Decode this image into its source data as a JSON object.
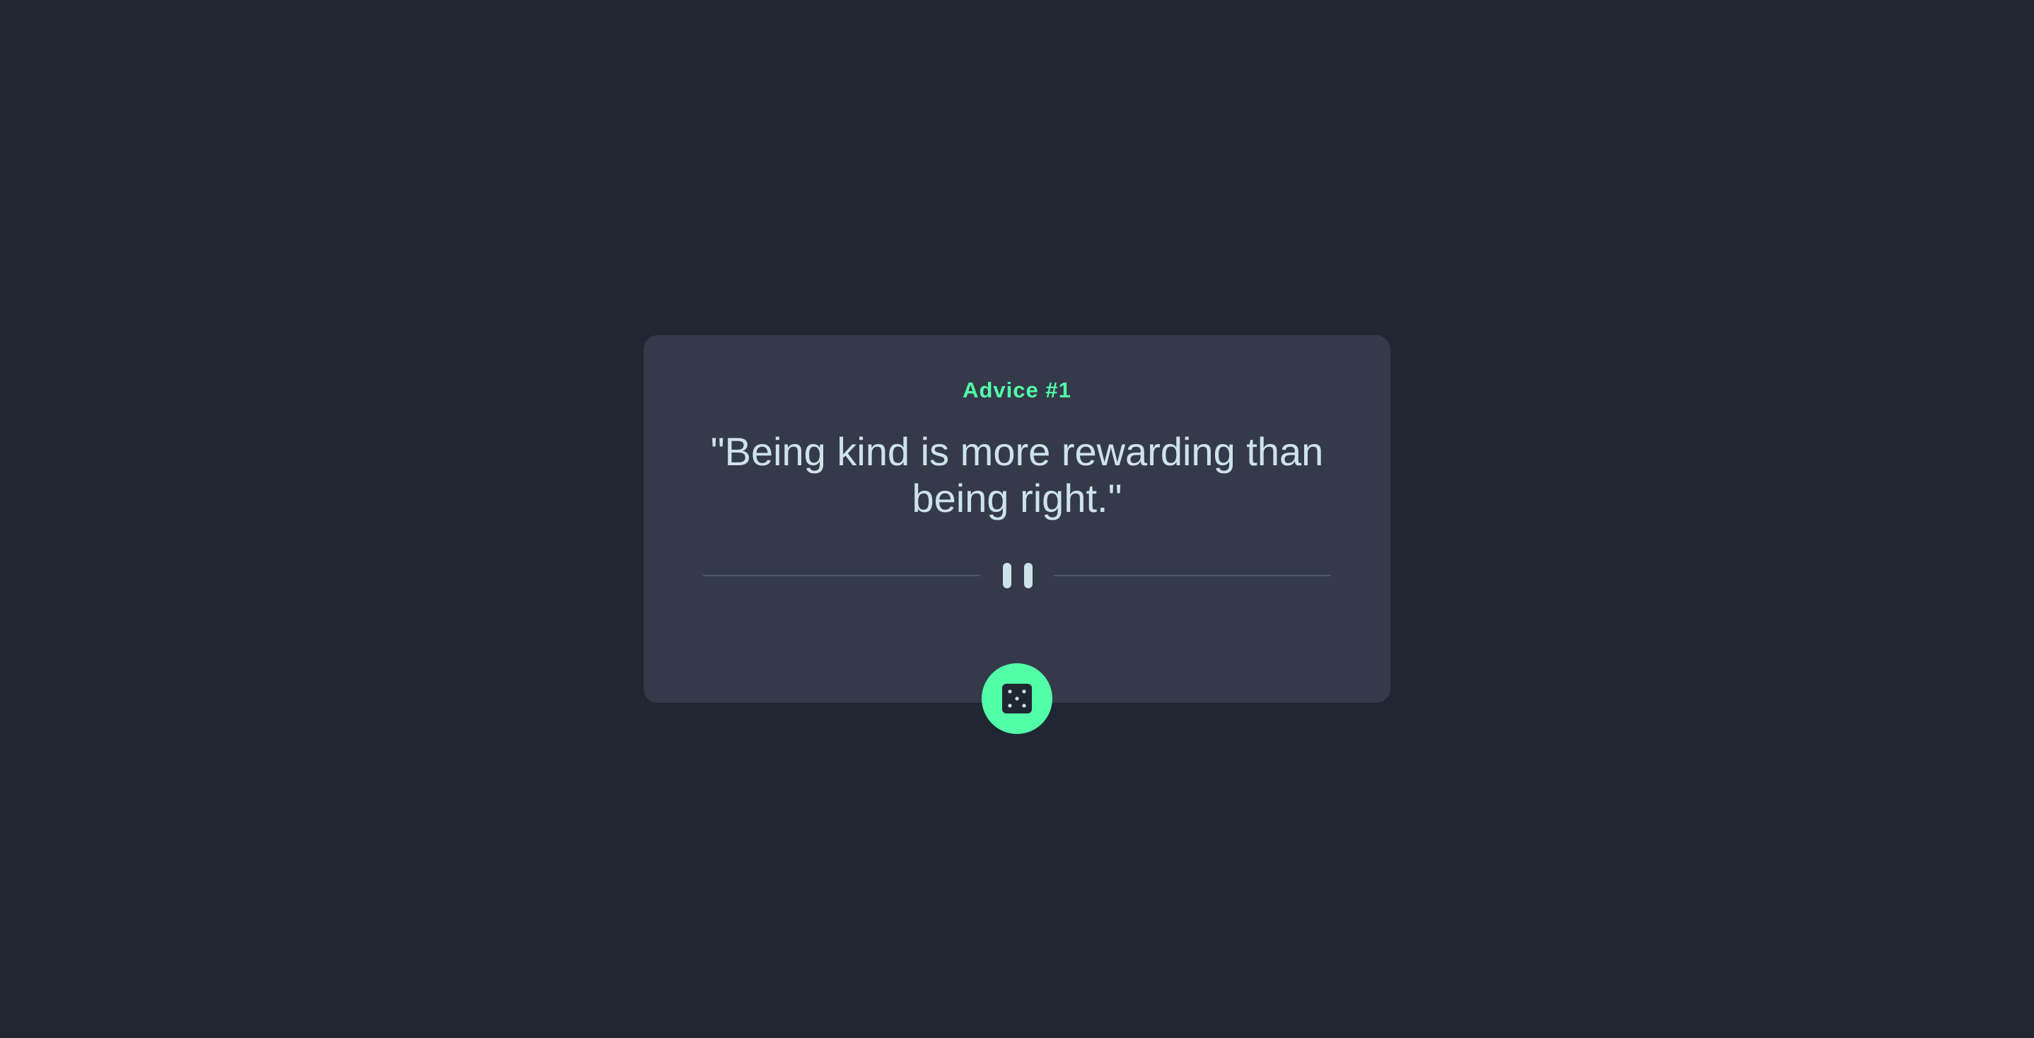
{
  "advice": {
    "label": "Advice #1",
    "quote": "\"Being kind is more rewarding than being right.\""
  },
  "icons": {
    "divider": "pause-icon",
    "generate": "dice-icon"
  },
  "colors": {
    "background": "#202632",
    "card": "#343a4a",
    "accent": "#52ffa8",
    "text": "#cee3e9",
    "divider_line": "#4f5766"
  }
}
